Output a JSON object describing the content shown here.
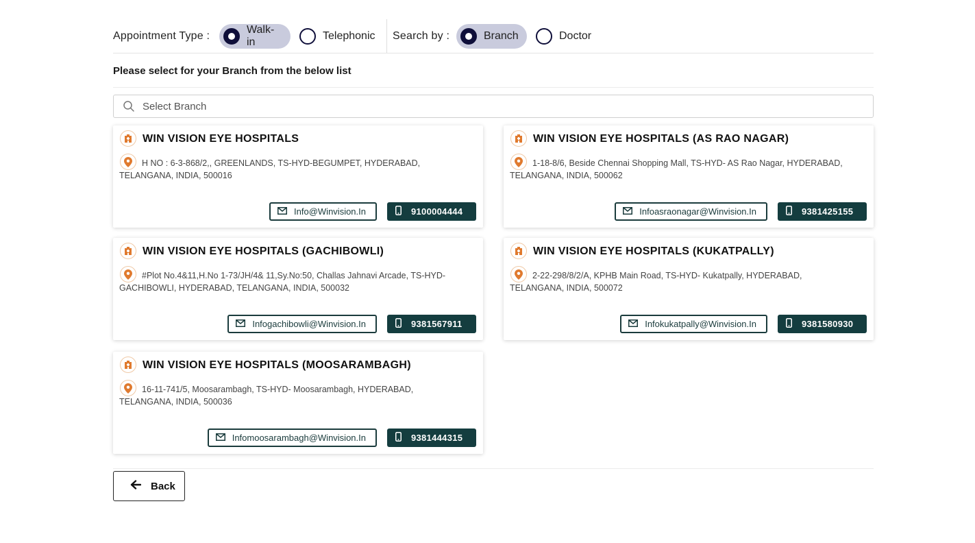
{
  "filters": {
    "appointment_type_label": "Appointment Type :",
    "appointment_options": [
      {
        "label": "Walk-in",
        "selected": true
      },
      {
        "label": "Telephonic",
        "selected": false
      }
    ],
    "search_by_label": "Search by :",
    "search_by_options": [
      {
        "label": "Branch",
        "selected": true
      },
      {
        "label": "Doctor",
        "selected": false
      }
    ]
  },
  "instruction": "Please select for your Branch from the below list",
  "search": {
    "placeholder": "Select Branch",
    "value": ""
  },
  "branches": [
    {
      "name": "WIN VISION EYE HOSPITALS",
      "address": "H NO : 6-3-868/2,, GREENLANDS, TS-HYD-BEGUMPET, HYDERABAD, TELANGANA, INDIA, 500016",
      "email": "Info@Winvision.In",
      "phone": "9100004444"
    },
    {
      "name": "WIN VISION EYE HOSPITALS (AS RAO NAGAR)",
      "address": "1-18-8/6, Beside Chennai Shopping Mall, TS-HYD- AS Rao Nagar, HYDERABAD, TELANGANA, INDIA, 500062",
      "email": "Infoasraonagar@Winvision.In",
      "phone": "9381425155"
    },
    {
      "name": "WIN VISION EYE HOSPITALS (GACHIBOWLI)",
      "address": "#Plot No.4&11,H.No 1-73/JH/4& 11,Sy.No:50, Challas Jahnavi Arcade, TS-HYD-GACHIBOWLI, HYDERABAD, TELANGANA, INDIA, 500032",
      "email": "Infogachibowli@Winvision.In",
      "phone": "9381567911"
    },
    {
      "name": "WIN VISION EYE HOSPITALS (KUKATPALLY)",
      "address": "2-22-298/8/2/A, KPHB Main Road, TS-HYD- Kukatpally, HYDERABAD, TELANGANA, INDIA, 500072",
      "email": "Infokukatpally@Winvision.In",
      "phone": "9381580930"
    },
    {
      "name": "WIN VISION EYE HOSPITALS (MOOSARAMBAGH)",
      "address": "16-11-741/5, Moosarambagh, TS-HYD- Moosarambagh, HYDERABAD, TELANGANA, INDIA, 500036",
      "email": "Infomoosarambagh@Winvision.In",
      "phone": "9381444315"
    }
  ],
  "back_label": "Back",
  "icons": {
    "search": "search-icon",
    "hospital": "hospital-icon",
    "location": "location-pin-icon",
    "email": "envelope-icon",
    "phone": "mobile-phone-icon",
    "back": "arrow-left-icon"
  },
  "colors": {
    "accent_dark": "#143d3f",
    "radio": "#0f0f3a",
    "pill_active": "#c9cbdd",
    "icon_orange": "#e07a2e"
  }
}
